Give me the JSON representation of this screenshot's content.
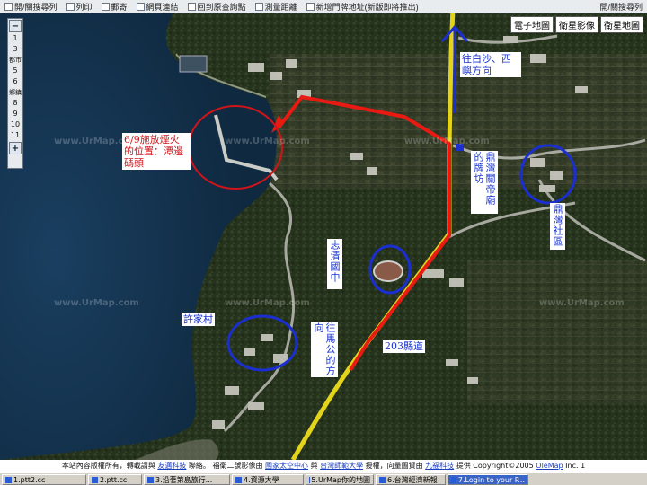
{
  "toolbar": {
    "items": [
      {
        "label": "開/關搜尋列",
        "icon": "search-panel-icon"
      },
      {
        "label": "列印",
        "icon": "printer-icon"
      },
      {
        "label": "郵寄",
        "icon": "mail-icon"
      },
      {
        "label": "網頁連結",
        "icon": "link-icon"
      },
      {
        "label": "回到原查詢點",
        "icon": "home-icon"
      },
      {
        "label": "測量距離",
        "icon": "ruler-icon"
      },
      {
        "label": "新增門牌地址(新版即將推出)",
        "icon": "pin-icon"
      }
    ],
    "right_label": "開/關搜尋列"
  },
  "map_types": [
    "電子地圖",
    "衛星影像",
    "衛星地圖"
  ],
  "zoom": {
    "levels": [
      "1",
      "3",
      "5",
      "6",
      "8",
      "9",
      "10",
      "11"
    ],
    "category_labels": [
      "都市",
      "鄉鎮"
    ],
    "plus": "+",
    "minus": "−"
  },
  "watermark": "www.UrMap.com",
  "labels": {
    "fire_site": "6/9施放煙火的位置：潭邊碼頭",
    "to_baisha": "往白沙、西嶼方向",
    "temple_arch": "鼎灣關帝廟的牌坊",
    "dingwan": "鼎灣社區",
    "zhiqing": "志清國中",
    "xujia": "許家村",
    "to_magong": "往馬公的方向",
    "county_road": "203縣道"
  },
  "colors": {
    "route": "#e81a12",
    "road_yellow": "#e3d31a",
    "annotation_blue": "#1b2fd0",
    "annotation_red": "#d0141a"
  },
  "footer": {
    "t1": "本站內容版權所有，轉載請與",
    "l1": "友邁科技",
    "t2": "聯絡。 福衛二號影像由",
    "l2": "國家太空中心",
    "t3": "與",
    "l3": "台灣師範大學",
    "t4": "授權，向量圖資由",
    "l4": "九福科技",
    "t5": "提供 Copyright©2005",
    "l5": "OleMap",
    "t6": "Inc. 1"
  },
  "taskbar": [
    {
      "label": "1.ptt2.cc",
      "active": false
    },
    {
      "label": "2.ptt.cc",
      "active": false
    },
    {
      "label": "3.沿著第島旅行...",
      "active": false
    },
    {
      "label": "4.資源大學",
      "active": false
    },
    {
      "label": "5.UrMap你的地圖",
      "active": false
    },
    {
      "label": "6.台灣經濟新報",
      "active": false
    },
    {
      "label": "7.Login to your P...",
      "active": true
    }
  ]
}
